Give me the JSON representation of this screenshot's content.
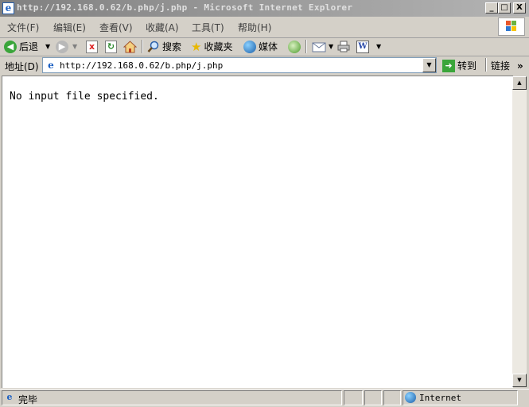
{
  "window": {
    "title": "http://192.168.0.62/b.php/j.php - Microsoft Internet Explorer",
    "minimize": "_",
    "maximize": "□",
    "close": "X"
  },
  "menu": {
    "items": [
      "文件(F)",
      "编辑(E)",
      "查看(V)",
      "收藏(A)",
      "工具(T)",
      "帮助(H)"
    ]
  },
  "toolbar": {
    "back_label": "后退",
    "search_label": "搜索",
    "favorites_label": "收藏夹",
    "media_label": "媒体"
  },
  "address": {
    "label": "地址(D)",
    "url": "http://192.168.0.62/b.php/j.php",
    "go_label": "转到",
    "links_label": "链接"
  },
  "page": {
    "text": "No input file specified."
  },
  "status": {
    "text": "完毕",
    "zone": "Internet"
  },
  "colors": {
    "window_bg": "#d4d0c8",
    "content_bg": "#ffffff"
  }
}
